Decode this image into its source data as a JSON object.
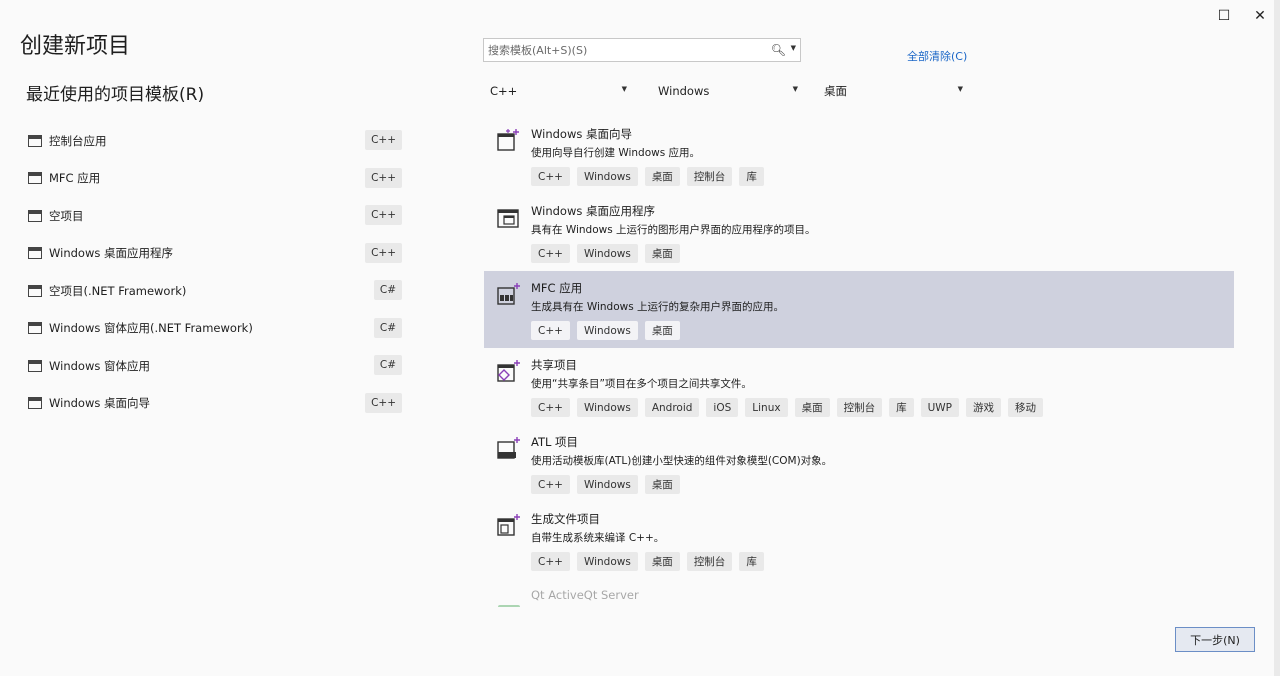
{
  "window_controls": {
    "maximize": "☐",
    "close": "✕"
  },
  "page_title": "创建新项目",
  "recent": {
    "title": "最近使用的项目模板(R)",
    "items": [
      {
        "label": "控制台应用",
        "tag": "C++"
      },
      {
        "label": "MFC 应用",
        "tag": "C++"
      },
      {
        "label": "空项目",
        "tag": "C++"
      },
      {
        "label": "Windows 桌面应用程序",
        "tag": "C++"
      },
      {
        "label": "空项目(.NET Framework)",
        "tag": "C#"
      },
      {
        "label": "Windows 窗体应用(.NET Framework)",
        "tag": "C#"
      },
      {
        "label": "Windows 窗体应用",
        "tag": "C#"
      },
      {
        "label": "Windows 桌面向导",
        "tag": "C++"
      }
    ]
  },
  "search": {
    "placeholder": "搜索模板(Alt+S)(S)",
    "value": ""
  },
  "clear_all": "全部清除(C)",
  "filters": {
    "language": "C++",
    "platform": "Windows",
    "project_type": "桌面"
  },
  "templates": [
    {
      "icon": "wizard-icon",
      "name": "Windows 桌面向导",
      "desc": "使用向导自行创建 Windows 应用。",
      "tags": [
        "C++",
        "Windows",
        "桌面",
        "控制台",
        "库"
      ]
    },
    {
      "icon": "desktop-app-icon",
      "name": "Windows 桌面应用程序",
      "desc": "具有在 Windows 上运行的图形用户界面的应用程序的项目。",
      "tags": [
        "C++",
        "Windows",
        "桌面"
      ]
    },
    {
      "icon": "mfc-icon",
      "name": "MFC 应用",
      "desc": "生成具有在 Windows 上运行的复杂用户界面的应用。",
      "tags": [
        "C++",
        "Windows",
        "桌面"
      ],
      "selected": true
    },
    {
      "icon": "shared-icon",
      "name": "共享项目",
      "desc": "使用“共享条目”项目在多个项目之间共享文件。",
      "tags": [
        "C++",
        "Windows",
        "Android",
        "iOS",
        "Linux",
        "桌面",
        "控制台",
        "库",
        "UWP",
        "游戏",
        "移动"
      ]
    },
    {
      "icon": "atl-icon",
      "name": "ATL 项目",
      "desc": "使用活动模板库(ATL)创建小型快速的组件对象模型(COM)对象。",
      "tags": [
        "C++",
        "Windows",
        "桌面"
      ]
    },
    {
      "icon": "makefile-icon",
      "name": "生成文件项目",
      "desc": "自带生成系统来编译 C++。",
      "tags": [
        "C++",
        "Windows",
        "桌面",
        "控制台",
        "库"
      ]
    },
    {
      "icon": "qt-icon",
      "name": "Qt ActiveQt Server",
      "desc": "",
      "tags": [],
      "faded": true
    }
  ],
  "next_button": "下一步(N)",
  "colors": {
    "selected_row": "#cfd1de",
    "link": "#1a66c7",
    "accent_purple": "#8a3fb8"
  }
}
